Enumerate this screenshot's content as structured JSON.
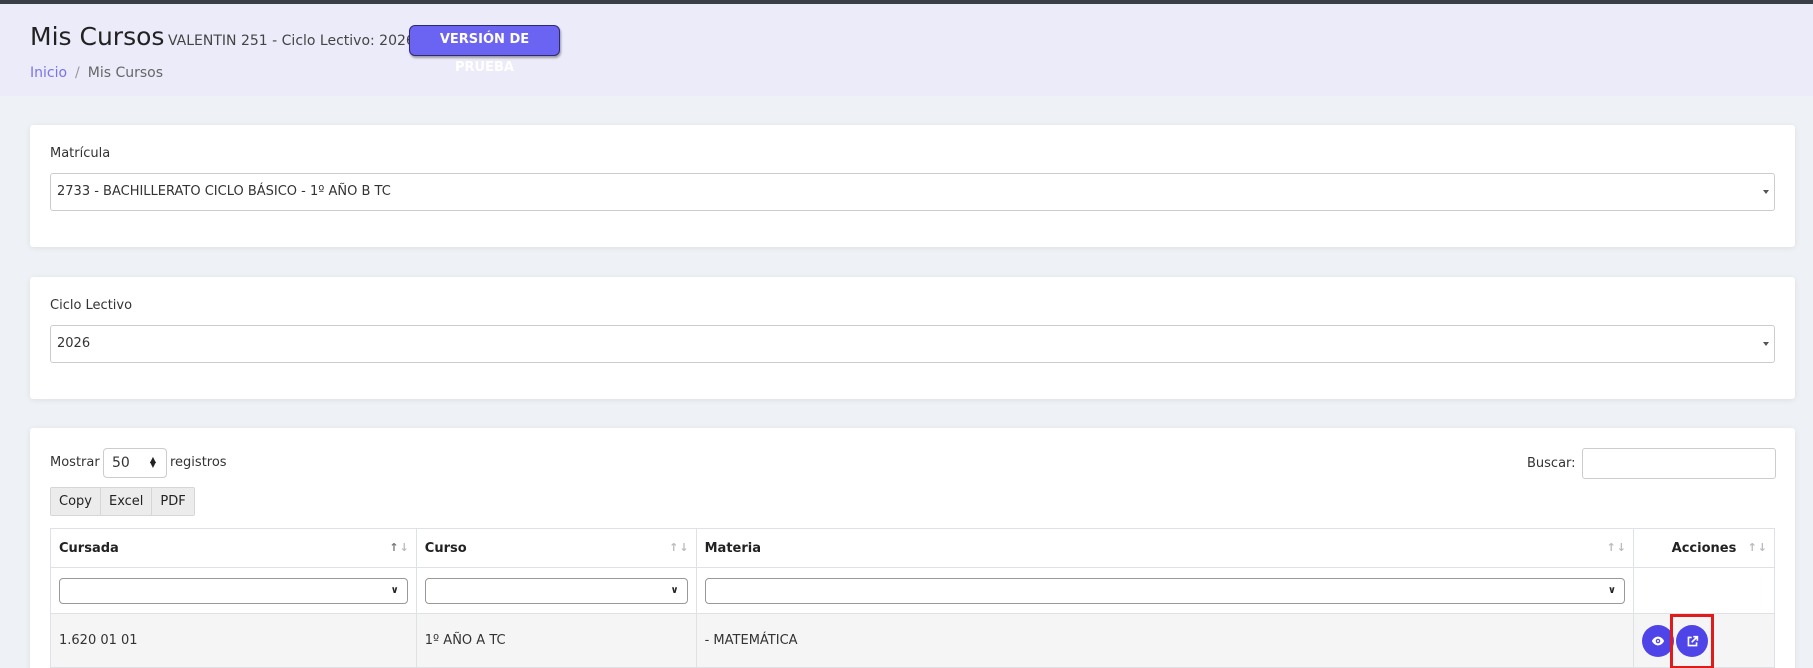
{
  "header": {
    "title": "Mis Cursos",
    "subtitle": "VALENTIN 251 - Ciclo Lectivo: 2026",
    "badge": "VERSIÓN DE PRUEBA"
  },
  "breadcrumb": {
    "home": "Inicio",
    "separator": "/",
    "current": "Mis Cursos"
  },
  "matricula": {
    "label": "Matrícula",
    "value": "2733 - BACHILLERATO CICLO BÁSICO - 1º AÑO B TC"
  },
  "ciclo": {
    "label": "Ciclo Lectivo",
    "value": "2026"
  },
  "table_controls": {
    "show_label": "Mostrar",
    "page_length": "50",
    "records_label": "registros",
    "search_label": "Buscar:",
    "export_buttons": [
      "Copy",
      "Excel",
      "PDF"
    ]
  },
  "table": {
    "columns": [
      "Cursada",
      "Curso",
      "Materia",
      "Acciones"
    ],
    "rows": [
      {
        "cursada": "1.620 01 01",
        "curso": "1º AÑO A TC",
        "materia": "- MATEMÁTICA"
      }
    ]
  },
  "icons": {
    "view": "eye-icon",
    "open": "external-link-icon"
  },
  "colors": {
    "accent": "#4e44e8",
    "badge": "#6b63f2",
    "highlight": "#e01b1b",
    "header_bg": "#ecebfa"
  }
}
